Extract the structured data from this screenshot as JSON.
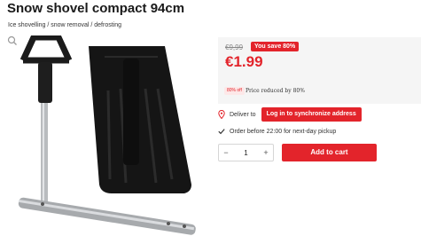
{
  "product": {
    "title": "Snow shovel compact 94cm",
    "breadcrumb": "Ice shovelling / snow removal / defrosting"
  },
  "gallery": {
    "image_alt": "snow-shovel-product-image",
    "zoom_icon": "magnifier-icon"
  },
  "price": {
    "old": "€9,99",
    "save_badge": "You save 80%",
    "current": "€1.99",
    "discount_badge": "80% off",
    "reduced_text": "Price reduced by 80%"
  },
  "delivery": {
    "location_icon": "location-pin-icon",
    "deliver_label": "Deliver to",
    "login_button": "Log in to synchronize address",
    "check_icon": "check-icon",
    "order_text": "Order before 22:00 for next-day pickup"
  },
  "cart": {
    "minus": "−",
    "quantity": "1",
    "plus": "+",
    "add_button": "Add to cart"
  },
  "colors": {
    "accent": "#e3242b",
    "price_box_bg": "#f5f5f5"
  }
}
